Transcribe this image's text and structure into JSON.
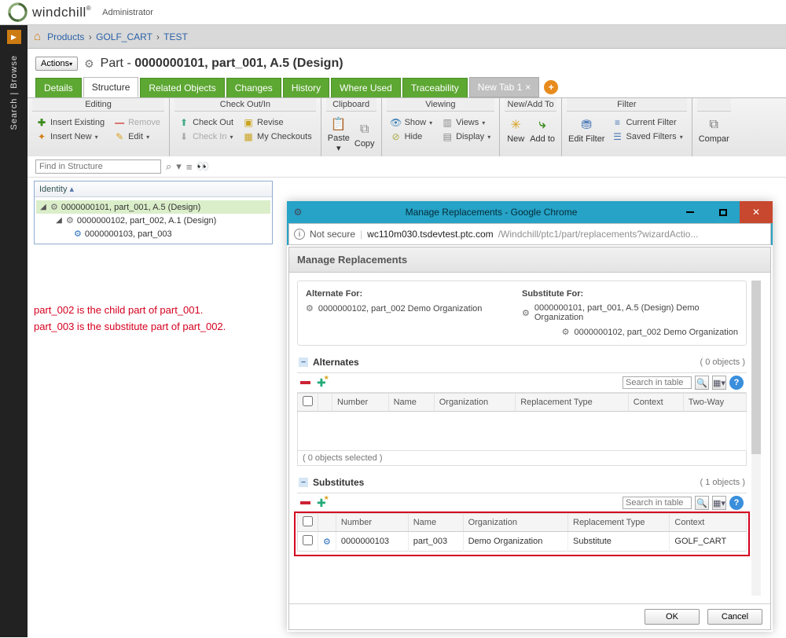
{
  "header": {
    "brand": "windchill",
    "admin": "Administrator"
  },
  "rail": {
    "label": "Search | Browse"
  },
  "breadcrumb": {
    "root": "Products",
    "mid": "GOLF_CART",
    "leaf": "TEST"
  },
  "page": {
    "actions": "Actions",
    "title_prefix": "Part - ",
    "title_bold": "0000000101, part_001, A.5 (Design)"
  },
  "tabs": {
    "items": [
      "Details",
      "Structure",
      "Related Objects",
      "Changes",
      "History",
      "Where Used",
      "Traceability"
    ],
    "newtab": "New Tab 1"
  },
  "ribbon": {
    "editing": {
      "title": "Editing",
      "insertExisting": "Insert Existing",
      "remove": "Remove",
      "insertNew": "Insert New",
      "edit": "Edit"
    },
    "check": {
      "title": "Check Out/In",
      "checkOut": "Check Out",
      "revise": "Revise",
      "checkIn": "Check In",
      "myCheckouts": "My Checkouts"
    },
    "clipboard": {
      "title": "Clipboard",
      "paste": "Paste",
      "copy": "Copy"
    },
    "viewing": {
      "title": "Viewing",
      "show": "Show",
      "views": "Views",
      "hide": "Hide",
      "display": "Display"
    },
    "newadd": {
      "title": "New/Add To",
      "new": "New",
      "addTo": "Add to"
    },
    "filter": {
      "title": "Filter",
      "editFilter": "Edit Filter",
      "currentFilter": "Current Filter",
      "savedFilters": "Saved Filters"
    },
    "compare": {
      "label": "Compar"
    }
  },
  "structSearch": {
    "placeholder": "Find in Structure"
  },
  "identity": {
    "header": "Identity",
    "n1": "0000000101, part_001, A.5 (Design)",
    "n2": "0000000102, part_002, A.1 (Design)",
    "n3": "0000000103, part_003"
  },
  "annotation": {
    "l1": "part_002 is the child part of part_001.",
    "l2": "part_003 is the substitute part of part_002."
  },
  "popup": {
    "title": "Manage Replacements - Google Chrome",
    "notSecure": "Not secure",
    "urlHost": "wc110m030.tsdevtest.ptc.com",
    "urlPath": "/Windchill/ptc1/part/replacements?wizardActio...",
    "heading": "Manage Replacements",
    "altFor": "Alternate For:",
    "subFor": "Substitute For:",
    "altLine": "0000000102, part_002 Demo Organization",
    "subLine1": "0000000101, part_001, A.5 (Design) Demo Organization",
    "subLine2": "0000000102, part_002 Demo Organization",
    "alternates": {
      "title": "Alternates",
      "count": "( 0 objects )",
      "searchPh": "Search in table",
      "status": "( 0 objects selected )"
    },
    "substitutes": {
      "title": "Substitutes",
      "count": "( 1 objects )",
      "searchPh": "Search in table"
    },
    "cols": {
      "number": "Number",
      "name": "Name",
      "org": "Organization",
      "reptype": "Replacement Type",
      "context": "Context",
      "twoway": "Two-Way"
    },
    "row": {
      "number": "0000000103",
      "name": "part_003",
      "org": "Demo Organization",
      "reptype": "Substitute",
      "context": "GOLF_CART"
    },
    "ok": "OK",
    "cancel": "Cancel"
  }
}
